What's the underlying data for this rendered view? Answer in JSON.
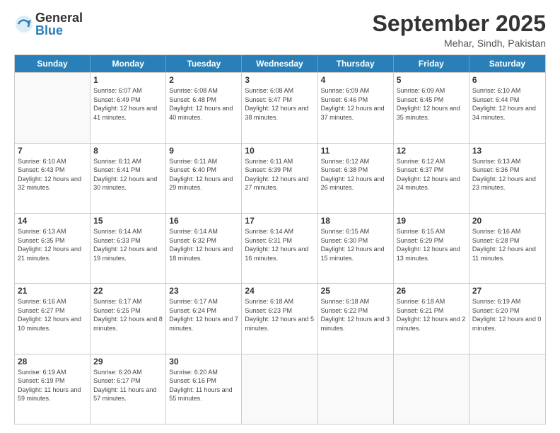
{
  "logo": {
    "general": "General",
    "blue": "Blue"
  },
  "header": {
    "month": "September 2025",
    "location": "Mehar, Sindh, Pakistan"
  },
  "days_of_week": [
    "Sunday",
    "Monday",
    "Tuesday",
    "Wednesday",
    "Thursday",
    "Friday",
    "Saturday"
  ],
  "weeks": [
    [
      {
        "day": "",
        "sunrise": "",
        "sunset": "",
        "daylight": ""
      },
      {
        "day": "1",
        "sunrise": "Sunrise: 6:07 AM",
        "sunset": "Sunset: 6:49 PM",
        "daylight": "Daylight: 12 hours and 41 minutes."
      },
      {
        "day": "2",
        "sunrise": "Sunrise: 6:08 AM",
        "sunset": "Sunset: 6:48 PM",
        "daylight": "Daylight: 12 hours and 40 minutes."
      },
      {
        "day": "3",
        "sunrise": "Sunrise: 6:08 AM",
        "sunset": "Sunset: 6:47 PM",
        "daylight": "Daylight: 12 hours and 38 minutes."
      },
      {
        "day": "4",
        "sunrise": "Sunrise: 6:09 AM",
        "sunset": "Sunset: 6:46 PM",
        "daylight": "Daylight: 12 hours and 37 minutes."
      },
      {
        "day": "5",
        "sunrise": "Sunrise: 6:09 AM",
        "sunset": "Sunset: 6:45 PM",
        "daylight": "Daylight: 12 hours and 35 minutes."
      },
      {
        "day": "6",
        "sunrise": "Sunrise: 6:10 AM",
        "sunset": "Sunset: 6:44 PM",
        "daylight": "Daylight: 12 hours and 34 minutes."
      }
    ],
    [
      {
        "day": "7",
        "sunrise": "Sunrise: 6:10 AM",
        "sunset": "Sunset: 6:43 PM",
        "daylight": "Daylight: 12 hours and 32 minutes."
      },
      {
        "day": "8",
        "sunrise": "Sunrise: 6:11 AM",
        "sunset": "Sunset: 6:41 PM",
        "daylight": "Daylight: 12 hours and 30 minutes."
      },
      {
        "day": "9",
        "sunrise": "Sunrise: 6:11 AM",
        "sunset": "Sunset: 6:40 PM",
        "daylight": "Daylight: 12 hours and 29 minutes."
      },
      {
        "day": "10",
        "sunrise": "Sunrise: 6:11 AM",
        "sunset": "Sunset: 6:39 PM",
        "daylight": "Daylight: 12 hours and 27 minutes."
      },
      {
        "day": "11",
        "sunrise": "Sunrise: 6:12 AM",
        "sunset": "Sunset: 6:38 PM",
        "daylight": "Daylight: 12 hours and 26 minutes."
      },
      {
        "day": "12",
        "sunrise": "Sunrise: 6:12 AM",
        "sunset": "Sunset: 6:37 PM",
        "daylight": "Daylight: 12 hours and 24 minutes."
      },
      {
        "day": "13",
        "sunrise": "Sunrise: 6:13 AM",
        "sunset": "Sunset: 6:36 PM",
        "daylight": "Daylight: 12 hours and 23 minutes."
      }
    ],
    [
      {
        "day": "14",
        "sunrise": "Sunrise: 6:13 AM",
        "sunset": "Sunset: 6:35 PM",
        "daylight": "Daylight: 12 hours and 21 minutes."
      },
      {
        "day": "15",
        "sunrise": "Sunrise: 6:14 AM",
        "sunset": "Sunset: 6:33 PM",
        "daylight": "Daylight: 12 hours and 19 minutes."
      },
      {
        "day": "16",
        "sunrise": "Sunrise: 6:14 AM",
        "sunset": "Sunset: 6:32 PM",
        "daylight": "Daylight: 12 hours and 18 minutes."
      },
      {
        "day": "17",
        "sunrise": "Sunrise: 6:14 AM",
        "sunset": "Sunset: 6:31 PM",
        "daylight": "Daylight: 12 hours and 16 minutes."
      },
      {
        "day": "18",
        "sunrise": "Sunrise: 6:15 AM",
        "sunset": "Sunset: 6:30 PM",
        "daylight": "Daylight: 12 hours and 15 minutes."
      },
      {
        "day": "19",
        "sunrise": "Sunrise: 6:15 AM",
        "sunset": "Sunset: 6:29 PM",
        "daylight": "Daylight: 12 hours and 13 minutes."
      },
      {
        "day": "20",
        "sunrise": "Sunrise: 6:16 AM",
        "sunset": "Sunset: 6:28 PM",
        "daylight": "Daylight: 12 hours and 11 minutes."
      }
    ],
    [
      {
        "day": "21",
        "sunrise": "Sunrise: 6:16 AM",
        "sunset": "Sunset: 6:27 PM",
        "daylight": "Daylight: 12 hours and 10 minutes."
      },
      {
        "day": "22",
        "sunrise": "Sunrise: 6:17 AM",
        "sunset": "Sunset: 6:25 PM",
        "daylight": "Daylight: 12 hours and 8 minutes."
      },
      {
        "day": "23",
        "sunrise": "Sunrise: 6:17 AM",
        "sunset": "Sunset: 6:24 PM",
        "daylight": "Daylight: 12 hours and 7 minutes."
      },
      {
        "day": "24",
        "sunrise": "Sunrise: 6:18 AM",
        "sunset": "Sunset: 6:23 PM",
        "daylight": "Daylight: 12 hours and 5 minutes."
      },
      {
        "day": "25",
        "sunrise": "Sunrise: 6:18 AM",
        "sunset": "Sunset: 6:22 PM",
        "daylight": "Daylight: 12 hours and 3 minutes."
      },
      {
        "day": "26",
        "sunrise": "Sunrise: 6:18 AM",
        "sunset": "Sunset: 6:21 PM",
        "daylight": "Daylight: 12 hours and 2 minutes."
      },
      {
        "day": "27",
        "sunrise": "Sunrise: 6:19 AM",
        "sunset": "Sunset: 6:20 PM",
        "daylight": "Daylight: 12 hours and 0 minutes."
      }
    ],
    [
      {
        "day": "28",
        "sunrise": "Sunrise: 6:19 AM",
        "sunset": "Sunset: 6:19 PM",
        "daylight": "Daylight: 11 hours and 59 minutes."
      },
      {
        "day": "29",
        "sunrise": "Sunrise: 6:20 AM",
        "sunset": "Sunset: 6:17 PM",
        "daylight": "Daylight: 11 hours and 57 minutes."
      },
      {
        "day": "30",
        "sunrise": "Sunrise: 6:20 AM",
        "sunset": "Sunset: 6:16 PM",
        "daylight": "Daylight: 11 hours and 55 minutes."
      },
      {
        "day": "",
        "sunrise": "",
        "sunset": "",
        "daylight": ""
      },
      {
        "day": "",
        "sunrise": "",
        "sunset": "",
        "daylight": ""
      },
      {
        "day": "",
        "sunrise": "",
        "sunset": "",
        "daylight": ""
      },
      {
        "day": "",
        "sunrise": "",
        "sunset": "",
        "daylight": ""
      }
    ]
  ]
}
